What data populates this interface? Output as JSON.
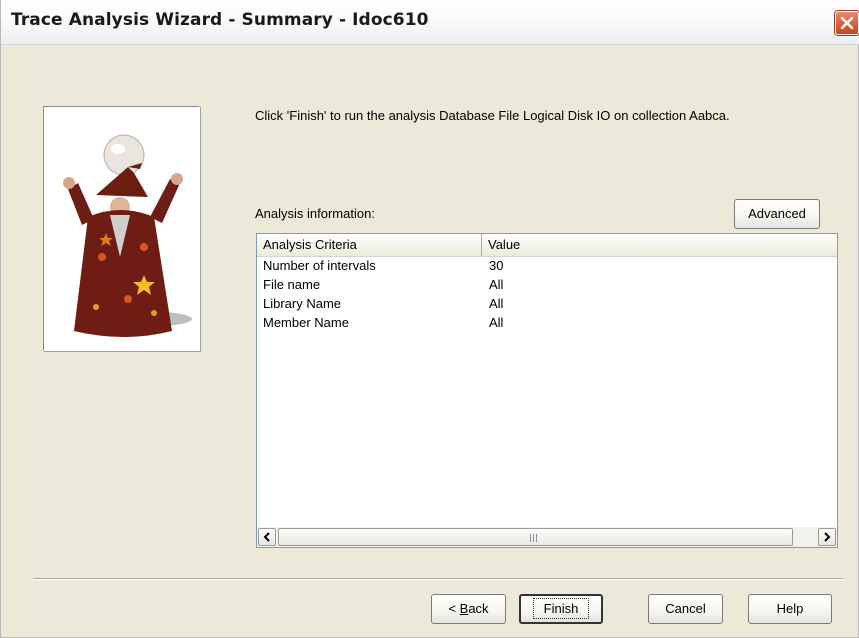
{
  "window": {
    "title": "Trace Analysis Wizard - Summary - Idoc610"
  },
  "content": {
    "instruction": "Click 'Finish' to run the analysis Database File Logical Disk IO on collection Aabca.",
    "analysis_label": "Analysis information:",
    "advanced_label": "Advanced"
  },
  "table": {
    "columns": [
      "Analysis Criteria",
      "Value"
    ],
    "rows": [
      {
        "criteria": "Number of intervals",
        "value": "30"
      },
      {
        "criteria": "File name",
        "value": "All"
      },
      {
        "criteria": "Library Name",
        "value": "All"
      },
      {
        "criteria": "Member Name",
        "value": "All"
      }
    ]
  },
  "footer": {
    "back_prefix": "< ",
    "back_accel": "B",
    "back_rest": "ack",
    "finish_label": "Finish",
    "cancel_label": "Cancel",
    "help_label": "Help"
  },
  "icons": {
    "close": "close-icon",
    "wizard": "wizard-image",
    "scroll_left": "arrow-left-icon",
    "scroll_right": "arrow-right-icon"
  }
}
